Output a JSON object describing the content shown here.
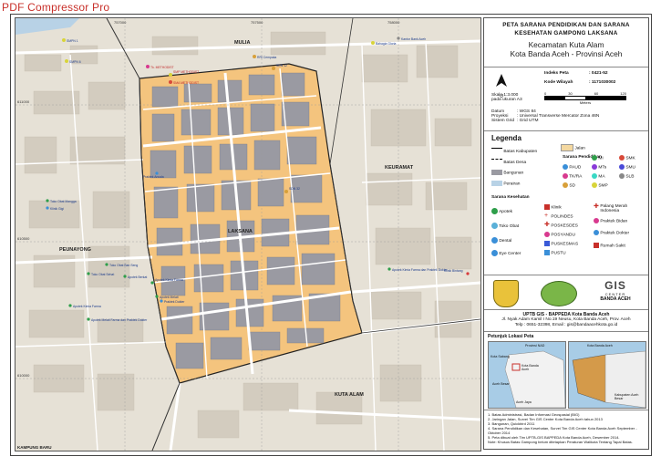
{
  "watermark": "PDF Compressor Pro",
  "header": {
    "title_line1": "PETA SARANA PENDIDIKAN DAN SARANA",
    "title_line2": "KESEHATAN GAMPONG LAKSANA",
    "subtitle_line1": "Kecamatan Kuta Alam",
    "subtitle_line2": "Kota Banda Aceh - Provinsi Aceh"
  },
  "info": {
    "north": "U",
    "index_label": "Indeks Peta",
    "index_value": ": 0421-52",
    "kode_label": "Kode Wilayah",
    "kode_value": ": 1171030002",
    "scale_text": "Skala 1:3.000",
    "scale_note": "pada ukuran A3",
    "scale_ticks": [
      "0",
      "30",
      "60",
      "120"
    ],
    "scale_unit": "Meters",
    "datum_label": "Datum",
    "datum_value": ": WGS 84",
    "proyeksi_label": "Proyeksi",
    "proyeksi_value": ": Universal Transverse Mercator Zona 46N",
    "grid_label": "Sistem Grid",
    "grid_value": ": Grid UTM"
  },
  "legend": {
    "title": "Legenda",
    "basic": [
      {
        "name": "batas-kabupaten",
        "label": "Batas Kabupaten"
      },
      {
        "name": "jalan",
        "label": "Jalan"
      },
      {
        "name": "batas-desa",
        "label": "Batas Desa"
      },
      {
        "name": "bangunan",
        "label": "Bangunan"
      },
      {
        "name": "perairan",
        "label": "Perairan"
      }
    ],
    "pendidikan_title": "Sarana Pendidikan",
    "pendidikan": [
      {
        "label": "PAUD",
        "color": "#3a8fd8"
      },
      {
        "label": "TK/RA",
        "color": "#d83a8f"
      },
      {
        "label": "SD",
        "color": "#d8a03a"
      },
      {
        "label": "MI",
        "color": "#2e9e4a"
      },
      {
        "label": "MTs",
        "color": "#8a3ad8"
      },
      {
        "label": "MA",
        "color": "#3ad8c4"
      },
      {
        "label": "SMP",
        "color": "#d8d43a"
      },
      {
        "label": "SMK",
        "color": "#d84a3a"
      },
      {
        "label": "SMU",
        "color": "#4a4ad8"
      },
      {
        "label": "SLB",
        "color": "#888888"
      }
    ],
    "kesehatan_title": "Sarana Kesehatan",
    "kesehatan": [
      {
        "label": "Apotek"
      },
      {
        "label": "Toko Obat"
      },
      {
        "label": "Dental"
      },
      {
        "label": "Eye Center"
      },
      {
        "label": "Klinik"
      },
      {
        "label": "POLINDES"
      },
      {
        "label": "POSKESDES"
      },
      {
        "label": "POSYANDU"
      },
      {
        "label": "PUSKESMAS"
      },
      {
        "label": "PUSTU"
      },
      {
        "label": "Palang Merah Indonesia"
      },
      {
        "label": "Praktek Bidan"
      },
      {
        "label": "Praktek Dokter"
      },
      {
        "label": "Rumah Sakit"
      }
    ]
  },
  "logos": {
    "gis_line1": "GIS",
    "gis_line2": "CENTER",
    "gis_line3": "BANDA ACEH"
  },
  "publisher": {
    "line1": "UPTB GIS - BAPPEDA Kota Banda Aceh",
    "line2": "Jl. Nyak Adam Kamil I No.19 Neusu, Kota Banda Aceh, Prov. Aceh",
    "line3": "Telp : 0651-32398, Email : gis@bandaacehkota.go.id"
  },
  "inset": {
    "title": "Petunjuk Lokasi Peta",
    "left_label_top": "Provinsi NAD",
    "left_label_sabang": "Kota Sabang",
    "left_label_banda": "Kota Banda Aceh",
    "left_label_besar": "Aceh Besar",
    "left_label_jaya": "Aceh Jaya",
    "right_label_top": "Kota Banda Aceh",
    "right_label_kab": "Kabupaten Aceh Besar"
  },
  "sources": [
    "1. Batas Administrasi, Badan Informasi Geospasial (BIG)",
    "2. Jaringan Jalan, Survei Tim GIS Center Kota Banda Aceh tahun 2013",
    "3. Bangunan, Quickbird 2011",
    "4. Sarana Pendidikan dan Kesehatan, Survei Tim GIS Center Kota Banda Aceh September - Oktober 2014",
    "5. Peta dibuat oleh Tim UPTB-GIS BAPPEDA Kota Banda Aceh, Desember 2014.",
    "Note: Khusus Batas Gampong belum ditetapkan Peraturan Walikota Tentang Tapal Batas."
  ],
  "map": {
    "areas": [
      "MULIA",
      "LAKSANA",
      "KEURAMAT",
      "PEUNAYONG",
      "KUTA ALAM",
      "KAMPUNG BARU"
    ],
    "grid_top": [
      "757000",
      "757500",
      "758000"
    ],
    "grid_left": [
      "611000",
      "610500",
      "610000"
    ],
    "pois": [
      "SMPN 1",
      "SMPN 6",
      "RRI Cempaka",
      "Tk. METHODIST",
      "SMP METHODIST",
      "SMA METHODIST",
      "Bahagia Gloria",
      "SDN 12",
      "SDN 32",
      "Praktek Ancala",
      "Toko Obat Sehat",
      "Apotek Berkat",
      "Apotek Kimia Farma",
      "Apotek Melati",
      "Klinik Bintang",
      "Toko Obat Mangga",
      "Praktek Dokter",
      "Apotek Melati Farma dan Praktek Dokter",
      "Apotek Kimia Farma",
      "Apotek Kimia Farma dan Praktek Dokter",
      "Klinik Gigi",
      "Toko Obat Ban Seng",
      "Kantor Bank Aceh",
      "Praktek Bidan Sekar",
      "Apotek Naseh",
      "Apotek Kimia Farma dan Praktek Dokter",
      "Apotek Rahmat"
    ]
  }
}
